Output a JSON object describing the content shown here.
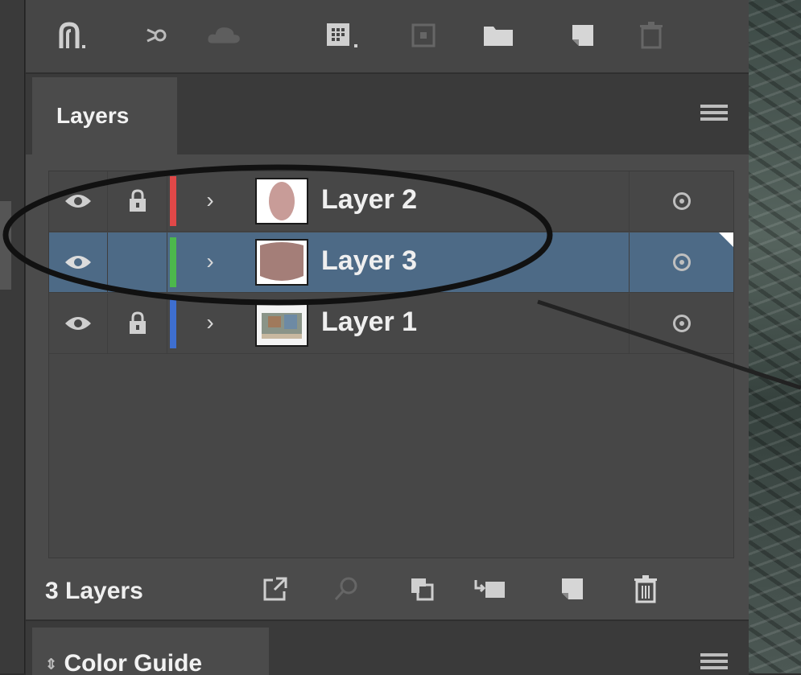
{
  "panel": {
    "toolbar_top_icons": [
      "arc-tool-icon",
      "share-icon",
      "cloud-icon",
      "grid-icon",
      "artboard-icon",
      "folder-icon",
      "new-layer-icon",
      "trash-icon"
    ],
    "tabs": [
      {
        "label": "Layers",
        "active": true
      }
    ],
    "layers": [
      {
        "name": "Layer 2",
        "color": "#e04848",
        "visible": true,
        "locked": true,
        "selected": false,
        "thumb": "pink-oval"
      },
      {
        "name": "Layer 3",
        "color": "#4cb84c",
        "visible": true,
        "locked": false,
        "selected": true,
        "thumb": "brown-shape"
      },
      {
        "name": "Layer 1",
        "color": "#3e6fd0",
        "visible": true,
        "locked": true,
        "selected": false,
        "thumb": "photo"
      }
    ],
    "footer": {
      "count_label": "3 Layers",
      "icons": [
        "export-icon",
        "search-icon",
        "clip-icon",
        "move-to-layer-icon",
        "new-sublayer-icon",
        "trash-icon"
      ]
    },
    "next_panel": {
      "label": "Color Guide"
    }
  },
  "colors": {
    "selected_row": "#4d6a86",
    "panel_bg": "#4b4b4b",
    "annotation": "#111111"
  }
}
